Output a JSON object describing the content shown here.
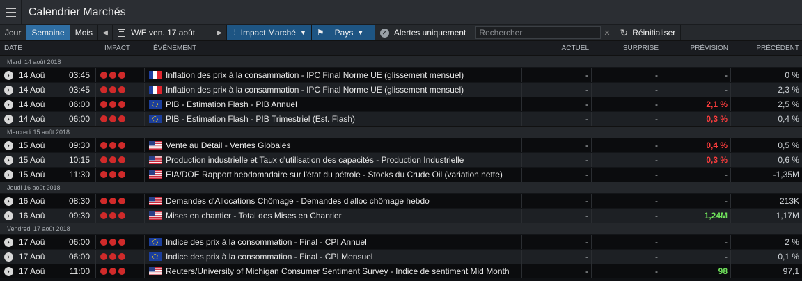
{
  "app": {
    "title": "Calendrier Marchés"
  },
  "toolbar": {
    "jour": "Jour",
    "semaine": "Semaine",
    "mois": "Mois",
    "week_label": "W/E ven. 17 août",
    "impact_label": "Impact Marché",
    "pays_label": "Pays",
    "alerts_label": "Alertes uniquement",
    "search_placeholder": "Rechercher",
    "reset_label": "Réinitialiser"
  },
  "headers": {
    "date": "DATE",
    "impact": "IMPACT",
    "event": "ÉVÉNEMENT",
    "actuel": "ACTUEL",
    "surprise": "SURPRISE",
    "prevision": "PRÉVISION",
    "precedent": "PRÉCÉDENT"
  },
  "groups": [
    {
      "label": "Mardi 14 août 2018"
    },
    {
      "label": "Mercredi 15 août 2018"
    },
    {
      "label": "Jeudi 16 août 2018"
    },
    {
      "label": "Vendredi 17 août 2018"
    }
  ],
  "rows": [
    {
      "date": "14 Aoû",
      "time": "03:45",
      "flag": "fr",
      "event": "Inflation des prix à la consammation - IPC Final Norme UE (glissement mensuel)",
      "actuel": "-",
      "surprise": "-",
      "prevision": "-",
      "prevision_color": "",
      "precedent": "0 %"
    },
    {
      "date": "14 Aoû",
      "time": "03:45",
      "flag": "fr",
      "event": "Inflation des prix à la consammation - IPC Final Norme UE (glissement mensuel)",
      "actuel": "-",
      "surprise": "-",
      "prevision": "-",
      "prevision_color": "",
      "precedent": "2,3 %"
    },
    {
      "date": "14 Aoû",
      "time": "06:00",
      "flag": "eu",
      "event": "PIB - Estimation Flash - PIB Annuel",
      "actuel": "-",
      "surprise": "-",
      "prevision": "2,1 %",
      "prevision_color": "red",
      "precedent": "2,5 %"
    },
    {
      "date": "14 Aoû",
      "time": "06:00",
      "flag": "eu",
      "event": "PIB - Estimation Flash - PIB Trimestriel (Est. Flash)",
      "actuel": "-",
      "surprise": "-",
      "prevision": "0,3 %",
      "prevision_color": "red",
      "precedent": "0,4 %"
    },
    {
      "date": "15 Aoû",
      "time": "09:30",
      "flag": "us",
      "event": "Vente au Détail - Ventes Globales",
      "actuel": "-",
      "surprise": "-",
      "prevision": "0,4 %",
      "prevision_color": "red",
      "precedent": "0,5 %"
    },
    {
      "date": "15 Aoû",
      "time": "10:15",
      "flag": "us",
      "event": "Production industrielle et Taux d'utilisation des capacités - Production Industrielle",
      "actuel": "-",
      "surprise": "-",
      "prevision": "0,3 %",
      "prevision_color": "red",
      "precedent": "0,6 %"
    },
    {
      "date": "15 Aoû",
      "time": "11:30",
      "flag": "us",
      "event": "EIA/DOE Rapport hebdomadaire sur l'état du pétrole - Stocks du Crude Oil (variation nette)",
      "actuel": "-",
      "surprise": "-",
      "prevision": "-",
      "prevision_color": "",
      "precedent": "-1,35M"
    },
    {
      "date": "16 Aoû",
      "time": "08:30",
      "flag": "us",
      "event": "Demandes d'Allocations Chômage - Demandes d'alloc chômage hebdo",
      "actuel": "-",
      "surprise": "-",
      "prevision": "-",
      "prevision_color": "",
      "precedent": "213K"
    },
    {
      "date": "16 Aoû",
      "time": "09:30",
      "flag": "us",
      "event": "Mises en chantier - Total des Mises en Chantier",
      "actuel": "-",
      "surprise": "-",
      "prevision": "1,24M",
      "prevision_color": "green",
      "precedent": "1,17M"
    },
    {
      "date": "17 Aoû",
      "time": "06:00",
      "flag": "eu",
      "event": "Indice des prix à la consommation - Final - CPI Annuel",
      "actuel": "-",
      "surprise": "-",
      "prevision": "-",
      "prevision_color": "",
      "precedent": "2 %"
    },
    {
      "date": "17 Aoû",
      "time": "06:00",
      "flag": "eu",
      "event": "Indice des prix à la consommation - Final - CPI Mensuel",
      "actuel": "-",
      "surprise": "-",
      "prevision": "-",
      "prevision_color": "",
      "precedent": "0,1 %"
    },
    {
      "date": "17 Aoû",
      "time": "11:00",
      "flag": "us",
      "event": "Reuters/University of Michigan Consumer Sentiment Survey - Indice de sentiment Mid Month",
      "actuel": "-",
      "surprise": "-",
      "prevision": "98",
      "prevision_color": "green",
      "precedent": "97,1"
    }
  ],
  "icons": {
    "menu": "hamburger-icon",
    "calendar": "calendar-icon",
    "impact": "grid-icon",
    "pays": "flag-icon",
    "alerts": "check-icon",
    "reset": "refresh-icon",
    "row": "chevron-right-icon"
  },
  "colors": {
    "impact_dot": "#d02a2a",
    "active_tab": "#2f6ea3",
    "forecast_down": "#ff3d3d",
    "forecast_up": "#6fe05b"
  }
}
